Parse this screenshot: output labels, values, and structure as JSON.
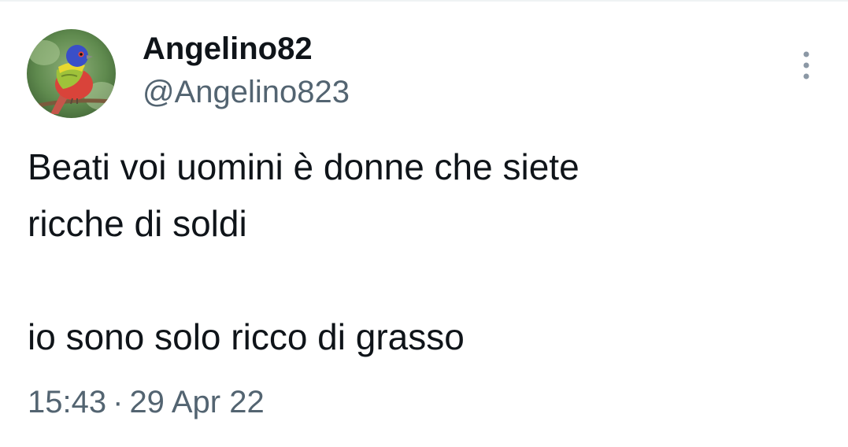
{
  "tweet": {
    "author": {
      "display_name": "Angelino82",
      "handle": "@Angelino823",
      "avatar_icon": "painted-bunting-bird-avatar"
    },
    "text_lines": [
      "Beati voi uomini è donne che siete",
      "ricche di soldi",
      "",
      "io sono solo ricco di grasso"
    ],
    "time": "15:43",
    "separator": "·",
    "date": "29 Apr 22",
    "more_icon": "more-vertical-icon"
  },
  "colors": {
    "text_primary": "#0f1419",
    "text_secondary": "#536471",
    "background": "#ffffff",
    "more_icon": "#8b98a5"
  }
}
